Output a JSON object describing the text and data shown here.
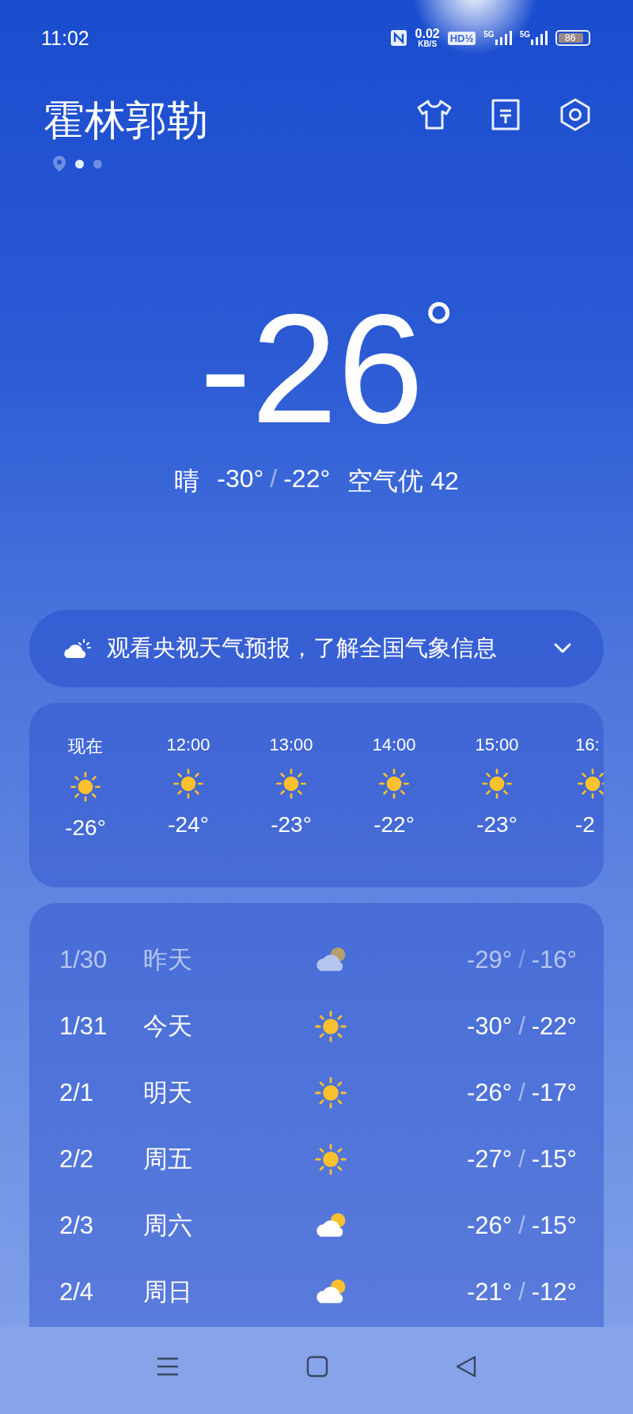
{
  "status_bar": {
    "time": "11:02",
    "speed": "0.02",
    "speed_unit": "KB/S",
    "hd": "HD",
    "hd_sub": "½",
    "network_1": "5G",
    "network_2": "5G",
    "battery": "86"
  },
  "header": {
    "city": "霍林郭勒",
    "pages": [
      {
        "kind": "location",
        "selected": false
      },
      {
        "kind": "dot",
        "selected": true
      },
      {
        "kind": "dot",
        "selected": false
      }
    ]
  },
  "current": {
    "temperature": "-26",
    "degree": "°",
    "condition": "晴",
    "low": "-30°",
    "separator": "/",
    "high": "-22°",
    "air_quality": "空气优 42"
  },
  "banner": {
    "text": "观看央视天气预报，了解全国气象信息",
    "expanded": false
  },
  "hourly": [
    {
      "time": "现在",
      "kind": "sunny",
      "temp": "-26°"
    },
    {
      "time": "12:00",
      "kind": "sunny",
      "temp": "-24°"
    },
    {
      "time": "13:00",
      "kind": "sunny",
      "temp": "-23°"
    },
    {
      "time": "14:00",
      "kind": "sunny",
      "temp": "-22°"
    },
    {
      "time": "15:00",
      "kind": "sunny",
      "temp": "-23°"
    },
    {
      "time": "16:",
      "kind": "sunny",
      "temp": "-2"
    }
  ],
  "daily": [
    {
      "date": "1/30",
      "day": "昨天",
      "kind": "partly_cloudy",
      "low": "-29°",
      "separator": "/",
      "high": "-16°",
      "past": true
    },
    {
      "date": "1/31",
      "day": "今天",
      "kind": "sunny",
      "low": "-30°",
      "separator": "/",
      "high": "-22°",
      "past": false
    },
    {
      "date": "2/1",
      "day": "明天",
      "kind": "sunny",
      "low": "-26°",
      "separator": "/",
      "high": "-17°",
      "past": false
    },
    {
      "date": "2/2",
      "day": "周五",
      "kind": "sunny",
      "low": "-27°",
      "separator": "/",
      "high": "-15°",
      "past": false
    },
    {
      "date": "2/3",
      "day": "周六",
      "kind": "partly_cloudy",
      "low": "-26°",
      "separator": "/",
      "high": "-15°",
      "past": false
    },
    {
      "date": "2/4",
      "day": "周日",
      "kind": "partly_cloudy",
      "low": "-21°",
      "separator": "/",
      "high": "-12°",
      "past": false
    }
  ]
}
